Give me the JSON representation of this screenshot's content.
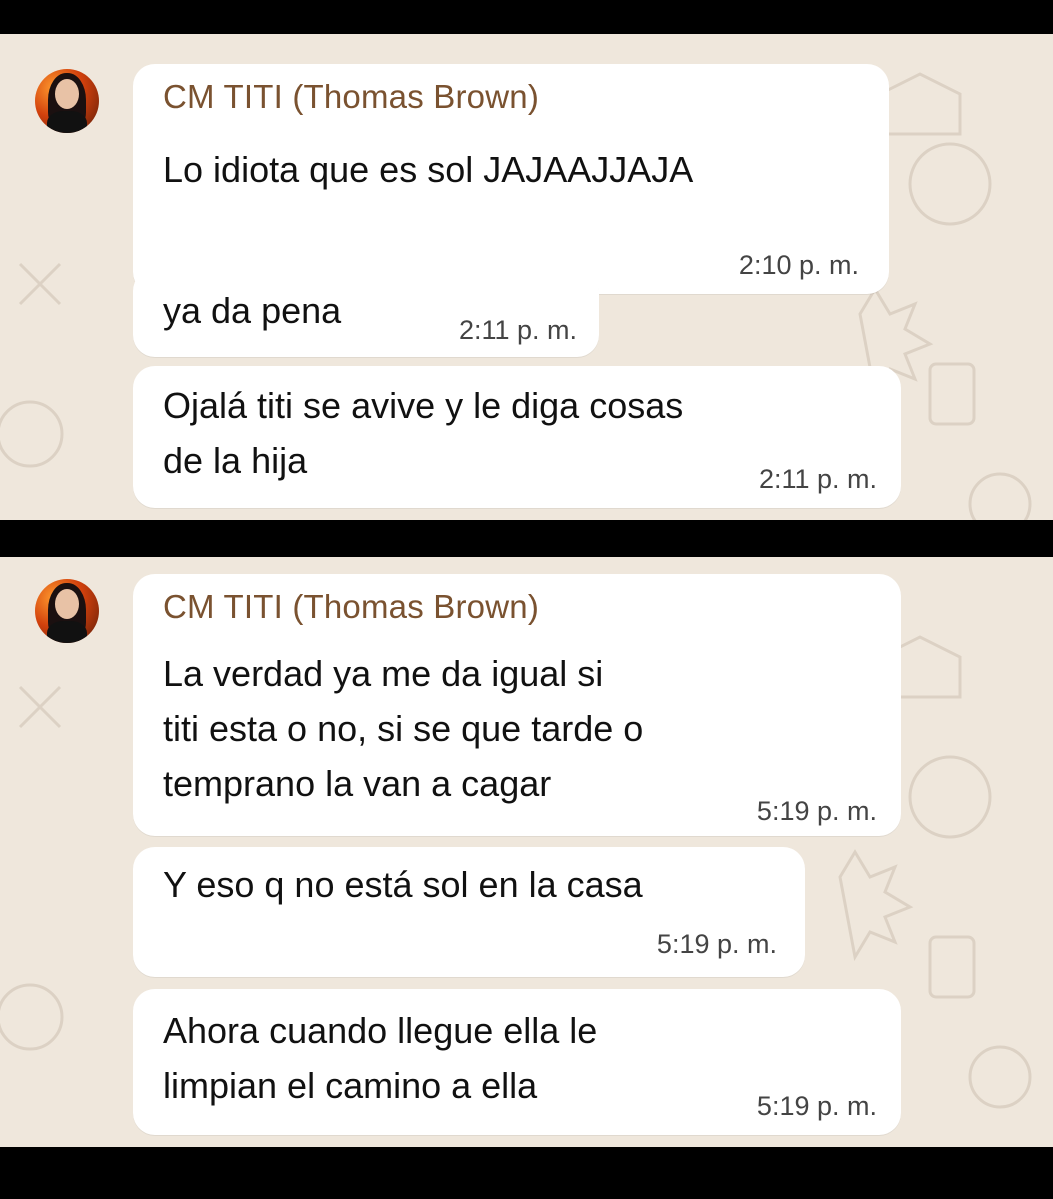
{
  "screenshots": [
    {
      "sender": "CM TITI (Thomas Brown)",
      "messages": [
        {
          "text": "Lo idiota que es sol JAJAAJJAJA",
          "time": "2:10 p. m."
        },
        {
          "text": "ya da pena",
          "time": "2:11 p. m."
        },
        {
          "text": "Ojalá titi se avive y le diga cosas\nde la hija",
          "time": "2:11 p. m."
        }
      ]
    },
    {
      "sender": "CM TITI (Thomas Brown)",
      "messages": [
        {
          "text": "La verdad ya me da igual si\ntiti esta o no, si se que tarde o\ntemprano la van a cagar",
          "time": "5:19 p. m."
        },
        {
          "text": "Y eso q no está sol en la casa",
          "time": "5:19 p. m."
        },
        {
          "text": "Ahora cuando llegue ella le\nlimpian el camino a ella",
          "time": "5:19 p. m."
        }
      ]
    }
  ],
  "colors": {
    "sender": "#7a5230",
    "chat_background": "#efe7dc",
    "bubble": "#ffffff"
  }
}
